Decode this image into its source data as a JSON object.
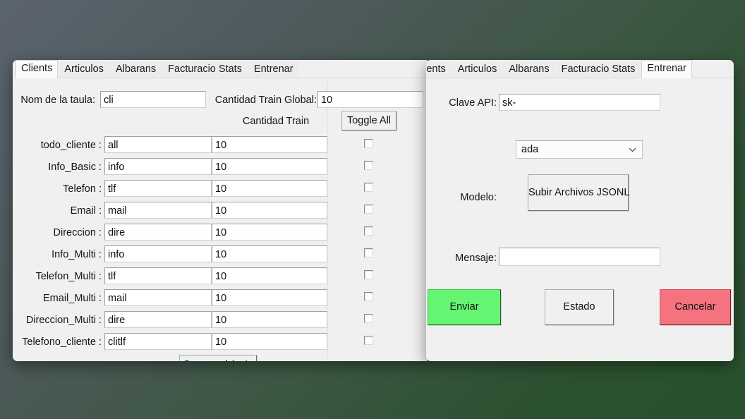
{
  "left_panel": {
    "tabs": [
      {
        "label": "Clients",
        "active": true
      },
      {
        "label": "Articulos",
        "active": false
      },
      {
        "label": "Albarans",
        "active": false
      },
      {
        "label": "Facturacio Stats",
        "active": false
      },
      {
        "label": "Entrenar",
        "active": false
      }
    ],
    "table_name_label": "Nom de la taula:",
    "table_name_value": "cli",
    "global_train_label": "Cantidad Train Global:",
    "global_train_value": "10",
    "column_header_train": "Cantidad Train",
    "toggle_all_label": "Toggle All",
    "generate_button_label": "Genera el Arxiu",
    "rows": [
      {
        "label": "todo_cliente :",
        "prefix": "all",
        "count": "10",
        "checked": false
      },
      {
        "label": "Info_Basic :",
        "prefix": "info",
        "count": "10",
        "checked": false
      },
      {
        "label": "Telefon :",
        "prefix": "tlf",
        "count": "10",
        "checked": false
      },
      {
        "label": "Email :",
        "prefix": "mail",
        "count": "10",
        "checked": false
      },
      {
        "label": "Direccion :",
        "prefix": "dire",
        "count": "10",
        "checked": false
      },
      {
        "label": "Info_Multi :",
        "prefix": "info",
        "count": "10",
        "checked": false
      },
      {
        "label": "Telefon_Multi :",
        "prefix": "tlf",
        "count": "10",
        "checked": false
      },
      {
        "label": "Email_Multi :",
        "prefix": "mail",
        "count": "10",
        "checked": false
      },
      {
        "label": "Direccion_Multi :",
        "prefix": "dire",
        "count": "10",
        "checked": false
      },
      {
        "label": "Telefono_cliente :",
        "prefix": "clitlf",
        "count": "10",
        "checked": false
      }
    ]
  },
  "right_panel": {
    "tabs": [
      {
        "label": "Clients",
        "active": false
      },
      {
        "label": "Articulos",
        "active": false
      },
      {
        "label": "Albarans",
        "active": false
      },
      {
        "label": "Facturacio Stats",
        "active": false
      },
      {
        "label": "Entrenar",
        "active": true
      }
    ],
    "api_key_label": "Clave API:",
    "api_key_value": "sk-",
    "model_select_value": "ada",
    "model_label": "Modelo:",
    "upload_button_label": "Subir Archivos JSONL",
    "message_label": "Mensaje:",
    "message_value": "",
    "send_button_label": "Enviar",
    "status_button_label": "Estado",
    "cancel_button_label": "Cancelar"
  },
  "colors": {
    "send_green": "#66f573",
    "cancel_red": "#f5737f",
    "panel_bg": "#f0f0f0",
    "field_bg": "#ffffff"
  }
}
